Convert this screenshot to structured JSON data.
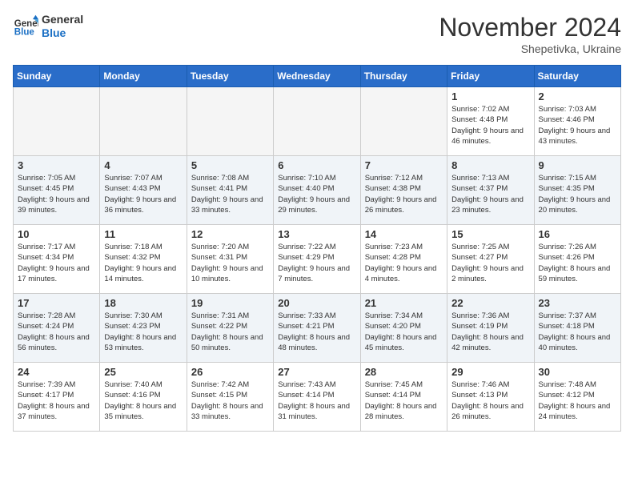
{
  "header": {
    "logo_line1": "General",
    "logo_line2": "Blue",
    "month": "November 2024",
    "location": "Shepetivka, Ukraine"
  },
  "weekdays": [
    "Sunday",
    "Monday",
    "Tuesday",
    "Wednesday",
    "Thursday",
    "Friday",
    "Saturday"
  ],
  "weeks": [
    [
      {
        "day": "",
        "info": ""
      },
      {
        "day": "",
        "info": ""
      },
      {
        "day": "",
        "info": ""
      },
      {
        "day": "",
        "info": ""
      },
      {
        "day": "",
        "info": ""
      },
      {
        "day": "1",
        "info": "Sunrise: 7:02 AM\nSunset: 4:48 PM\nDaylight: 9 hours and 46 minutes."
      },
      {
        "day": "2",
        "info": "Sunrise: 7:03 AM\nSunset: 4:46 PM\nDaylight: 9 hours and 43 minutes."
      }
    ],
    [
      {
        "day": "3",
        "info": "Sunrise: 7:05 AM\nSunset: 4:45 PM\nDaylight: 9 hours and 39 minutes."
      },
      {
        "day": "4",
        "info": "Sunrise: 7:07 AM\nSunset: 4:43 PM\nDaylight: 9 hours and 36 minutes."
      },
      {
        "day": "5",
        "info": "Sunrise: 7:08 AM\nSunset: 4:41 PM\nDaylight: 9 hours and 33 minutes."
      },
      {
        "day": "6",
        "info": "Sunrise: 7:10 AM\nSunset: 4:40 PM\nDaylight: 9 hours and 29 minutes."
      },
      {
        "day": "7",
        "info": "Sunrise: 7:12 AM\nSunset: 4:38 PM\nDaylight: 9 hours and 26 minutes."
      },
      {
        "day": "8",
        "info": "Sunrise: 7:13 AM\nSunset: 4:37 PM\nDaylight: 9 hours and 23 minutes."
      },
      {
        "day": "9",
        "info": "Sunrise: 7:15 AM\nSunset: 4:35 PM\nDaylight: 9 hours and 20 minutes."
      }
    ],
    [
      {
        "day": "10",
        "info": "Sunrise: 7:17 AM\nSunset: 4:34 PM\nDaylight: 9 hours and 17 minutes."
      },
      {
        "day": "11",
        "info": "Sunrise: 7:18 AM\nSunset: 4:32 PM\nDaylight: 9 hours and 14 minutes."
      },
      {
        "day": "12",
        "info": "Sunrise: 7:20 AM\nSunset: 4:31 PM\nDaylight: 9 hours and 10 minutes."
      },
      {
        "day": "13",
        "info": "Sunrise: 7:22 AM\nSunset: 4:29 PM\nDaylight: 9 hours and 7 minutes."
      },
      {
        "day": "14",
        "info": "Sunrise: 7:23 AM\nSunset: 4:28 PM\nDaylight: 9 hours and 4 minutes."
      },
      {
        "day": "15",
        "info": "Sunrise: 7:25 AM\nSunset: 4:27 PM\nDaylight: 9 hours and 2 minutes."
      },
      {
        "day": "16",
        "info": "Sunrise: 7:26 AM\nSunset: 4:26 PM\nDaylight: 8 hours and 59 minutes."
      }
    ],
    [
      {
        "day": "17",
        "info": "Sunrise: 7:28 AM\nSunset: 4:24 PM\nDaylight: 8 hours and 56 minutes."
      },
      {
        "day": "18",
        "info": "Sunrise: 7:30 AM\nSunset: 4:23 PM\nDaylight: 8 hours and 53 minutes."
      },
      {
        "day": "19",
        "info": "Sunrise: 7:31 AM\nSunset: 4:22 PM\nDaylight: 8 hours and 50 minutes."
      },
      {
        "day": "20",
        "info": "Sunrise: 7:33 AM\nSunset: 4:21 PM\nDaylight: 8 hours and 48 minutes."
      },
      {
        "day": "21",
        "info": "Sunrise: 7:34 AM\nSunset: 4:20 PM\nDaylight: 8 hours and 45 minutes."
      },
      {
        "day": "22",
        "info": "Sunrise: 7:36 AM\nSunset: 4:19 PM\nDaylight: 8 hours and 42 minutes."
      },
      {
        "day": "23",
        "info": "Sunrise: 7:37 AM\nSunset: 4:18 PM\nDaylight: 8 hours and 40 minutes."
      }
    ],
    [
      {
        "day": "24",
        "info": "Sunrise: 7:39 AM\nSunset: 4:17 PM\nDaylight: 8 hours and 37 minutes."
      },
      {
        "day": "25",
        "info": "Sunrise: 7:40 AM\nSunset: 4:16 PM\nDaylight: 8 hours and 35 minutes."
      },
      {
        "day": "26",
        "info": "Sunrise: 7:42 AM\nSunset: 4:15 PM\nDaylight: 8 hours and 33 minutes."
      },
      {
        "day": "27",
        "info": "Sunrise: 7:43 AM\nSunset: 4:14 PM\nDaylight: 8 hours and 31 minutes."
      },
      {
        "day": "28",
        "info": "Sunrise: 7:45 AM\nSunset: 4:14 PM\nDaylight: 8 hours and 28 minutes."
      },
      {
        "day": "29",
        "info": "Sunrise: 7:46 AM\nSunset: 4:13 PM\nDaylight: 8 hours and 26 minutes."
      },
      {
        "day": "30",
        "info": "Sunrise: 7:48 AM\nSunset: 4:12 PM\nDaylight: 8 hours and 24 minutes."
      }
    ]
  ]
}
